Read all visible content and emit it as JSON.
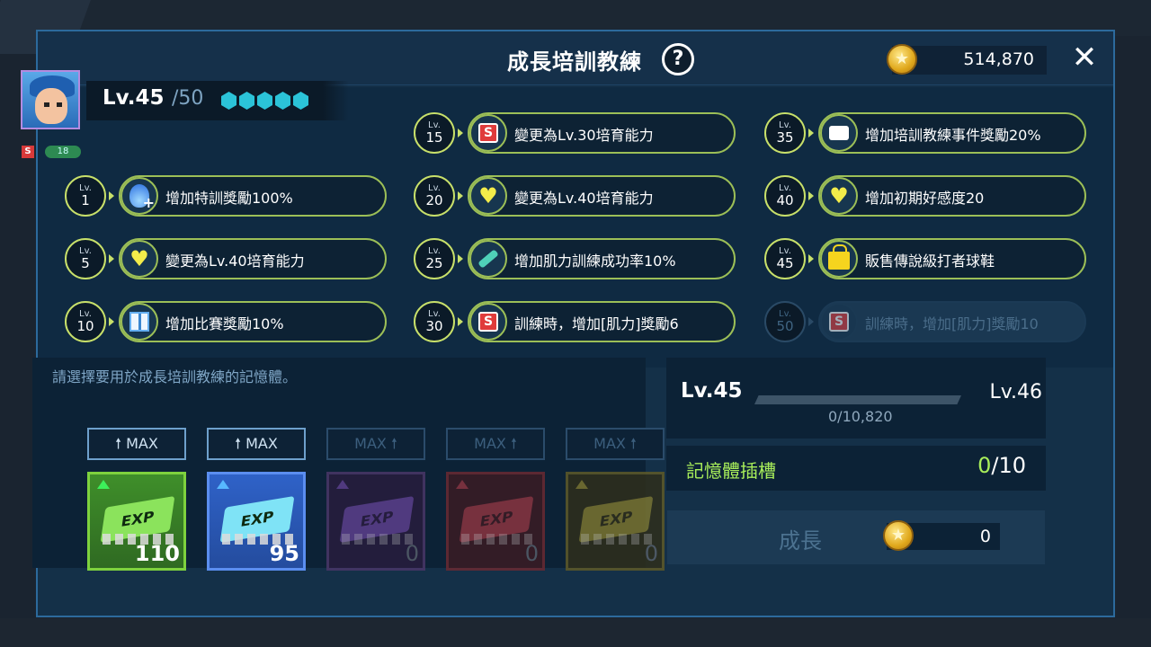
{
  "header": {
    "title": "成長培訓教練",
    "help_label": "?",
    "coins": "514,870",
    "close_label": "✕"
  },
  "player": {
    "level": "Lv.45",
    "max_level": "/50",
    "rank": "S",
    "badge_level": "18",
    "stars": 5
  },
  "rewards": [
    {
      "lv_label": "Lv.",
      "lv": "1",
      "icon": "blue-flame-plus-icon",
      "text": "增加特訓獎勵100%",
      "locked": false
    },
    {
      "lv_label": "Lv.",
      "lv": "5",
      "icon": "heart-icon",
      "text": "變更為Lv.40培育能力",
      "locked": false
    },
    {
      "lv_label": "Lv.",
      "lv": "10",
      "icon": "gift-icon",
      "text": "增加比賽獎勵10%",
      "locked": false
    },
    {
      "lv_label": "Lv.",
      "lv": "15",
      "icon": "s-rank-icon",
      "text": "變更為Lv.30培育能力",
      "locked": false
    },
    {
      "lv_label": "Lv.",
      "lv": "20",
      "icon": "heart-icon",
      "text": "變更為Lv.40培育能力",
      "locked": false
    },
    {
      "lv_label": "Lv.",
      "lv": "25",
      "icon": "dumbbell-icon",
      "text": "增加肌力訓練成功率10%",
      "locked": false
    },
    {
      "lv_label": "Lv.",
      "lv": "30",
      "icon": "s-rank-icon",
      "text": "訓練時，增加[肌力]獎勵6",
      "locked": false
    },
    {
      "lv_label": "Lv.",
      "lv": "35",
      "icon": "chat-icon",
      "text": "增加培訓教練事件獎勵20%",
      "locked": false
    },
    {
      "lv_label": "Lv.",
      "lv": "40",
      "icon": "heart-icon",
      "text": "增加初期好感度20",
      "locked": false
    },
    {
      "lv_label": "Lv.",
      "lv": "45",
      "icon": "shopping-bag-icon",
      "text": "販售傳說級打者球鞋",
      "locked": false
    },
    {
      "lv_label": "Lv.",
      "lv": "50",
      "icon": "s-rank-icon",
      "text": "訓練時，增加[肌力]獎勵10",
      "locked": true
    }
  ],
  "memory": {
    "hint": "請選擇要用於成長培訓教練的記憶體。",
    "max_buttons": [
      {
        "label": "🠕 MAX",
        "enabled": true
      },
      {
        "label": "🠕 MAX",
        "enabled": true
      },
      {
        "label": "MAX 🠕",
        "enabled": false
      },
      {
        "label": "MAX 🠕",
        "enabled": false
      },
      {
        "label": "MAX 🠕",
        "enabled": false
      }
    ],
    "chips": [
      {
        "color": "green",
        "label": "EXP",
        "count": "110"
      },
      {
        "color": "blue",
        "label": "EXP",
        "count": "95"
      },
      {
        "color": "purple",
        "label": "EXP",
        "count": "0"
      },
      {
        "color": "red",
        "label": "EXP",
        "count": "0"
      },
      {
        "color": "yellow",
        "label": "EXP",
        "count": "0"
      }
    ]
  },
  "progress": {
    "from": "Lv.45",
    "to": "Lv.46",
    "exp": "0/10,820",
    "fraction": 0
  },
  "slots": {
    "label": "記憶體插槽",
    "used": "0",
    "total": "/10"
  },
  "grow": {
    "label": "成長",
    "cost": "0"
  },
  "colors": {
    "accent_green": "#a8ee5a",
    "dialog_bg": "#143048",
    "border_blue": "#2c6a9c"
  }
}
